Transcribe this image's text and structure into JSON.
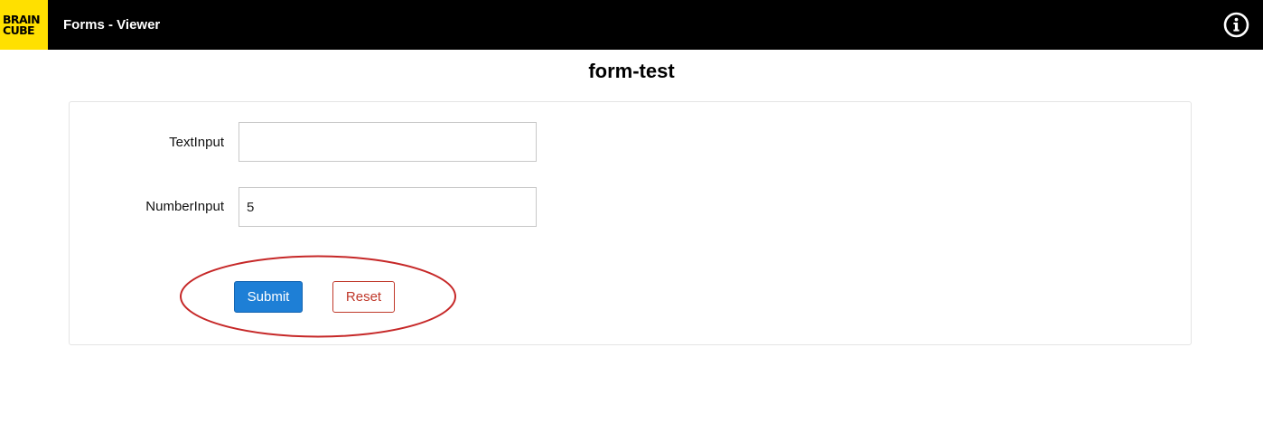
{
  "header": {
    "logo_line1": "BRAIN",
    "logo_line2": "CUBE",
    "app_title": "Forms - Viewer",
    "info_icon": "info-circle-icon"
  },
  "form": {
    "title": "form-test",
    "fields": [
      {
        "label": "TextInput",
        "value": "",
        "placeholder": ""
      },
      {
        "label": "NumberInput",
        "value": "5",
        "placeholder": ""
      }
    ],
    "submit_label": "Submit",
    "reset_label": "Reset"
  },
  "colors": {
    "header_bg": "#000000",
    "logo_bg": "#ffe000",
    "submit_bg": "#1e7fd6",
    "reset_border": "#c0392b",
    "annotation_stroke": "#c62828"
  }
}
